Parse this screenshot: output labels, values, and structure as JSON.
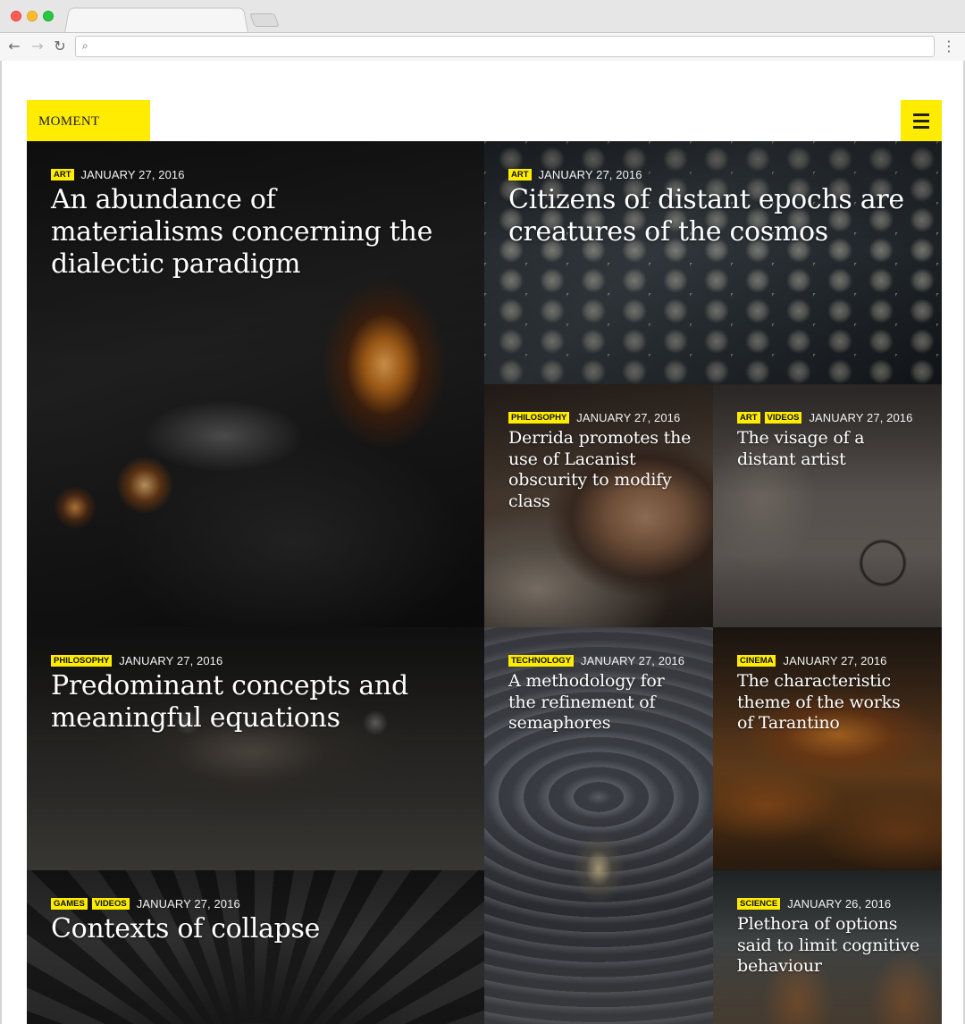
{
  "browser": {
    "url": "",
    "nav": {
      "back": "←",
      "forward": "→",
      "reload": "↻",
      "search_glyph": "⌕",
      "menu_glyph": "⋮"
    }
  },
  "site": {
    "logo": "MOMENT",
    "accent": "#ffec00"
  },
  "posts": [
    {
      "tags": [
        "ART"
      ],
      "date": "JANUARY 27, 2016",
      "title": "An abundance of materialisms concerning the dialectic paradigm"
    },
    {
      "tags": [
        "ART"
      ],
      "date": "JANUARY 27, 2016",
      "title": "Citizens of distant epochs are creatures of the cosmos"
    },
    {
      "tags": [
        "PHILOSOPHY"
      ],
      "date": "JANUARY 27, 2016",
      "title": "Derrida promotes the use of Lacanist obscurity to modify class"
    },
    {
      "tags": [
        "ART",
        "VIDEOS"
      ],
      "date": "JANUARY 27, 2016",
      "title": "The visage of a distant artist"
    },
    {
      "tags": [
        "PHILOSOPHY"
      ],
      "date": "JANUARY 27, 2016",
      "title": "Predominant concepts and meaningful equations"
    },
    {
      "tags": [
        "TECHNOLOGY"
      ],
      "date": "JANUARY 27, 2016",
      "title": "A methodology for the refinement of semaphores"
    },
    {
      "tags": [
        "CINEMA"
      ],
      "date": "JANUARY 27, 2016",
      "title": "The characteristic theme of the works of Tarantino"
    },
    {
      "tags": [
        "GAMES",
        "VIDEOS"
      ],
      "date": "JANUARY 27, 2016",
      "title": "Contexts of collapse"
    },
    {
      "tags": [
        "SCIENCE"
      ],
      "date": "JANUARY 26, 2016",
      "title": "Plethora of options said to limit cognitive behaviour"
    }
  ]
}
